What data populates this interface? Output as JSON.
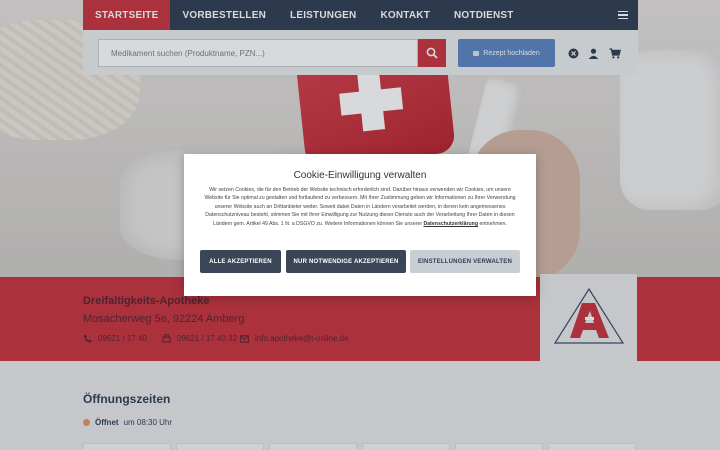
{
  "nav": {
    "items": [
      "STARTSEITE",
      "VORBESTELLEN",
      "LEISTUNGEN",
      "KONTAKT",
      "NOTDIENST"
    ],
    "active_index": 0,
    "menu_icon": "hamburger-icon"
  },
  "search": {
    "placeholder": "Medikament suchen (Produktname, PZN...)",
    "value": "",
    "button_icon": "search-icon"
  },
  "rezept": {
    "label": "Rezept hochladen",
    "icon": "camera-icon"
  },
  "header_icons": [
    "close-circle-icon",
    "user-icon",
    "cart-icon"
  ],
  "pharmacy": {
    "name": "Dreifaltigkeits-Apotheke",
    "address": "Mosacherweg 5e, 92224 Amberg",
    "phone": "09621 / 17 40",
    "fax": "09621 / 17 40 32",
    "email": "info.apotheke@t-online.de"
  },
  "hours": {
    "title": "Öffnungszeiten",
    "status_label": "Öffnet",
    "status_text": "um 08:30 Uhr"
  },
  "cookie_modal": {
    "title": "Cookie-Einwilligung verwalten",
    "text": "Wir setzen Cookies, die für den Betrieb der Website technisch erforderlich sind. Darüber hinaus verwenden wir Cookies, um unsere Website für Sie optimal zu gestalten und fortlaufend zu verbessern. Mit Ihrer Zustimmung geben wir Informationen zu Ihrer Verwendung unserer Website auch an Drittanbieter weiter. Soweit dabei Daten in Ländern verarbeitet werden, in denen kein angemessenes Datenschutzniveau besteht, stimmen Sie mit Ihrer Einwilligung zur Nutzung dieser Dienste auch der Verarbeitung Ihrer Daten in diesen Ländern gem. Artikel 49 Abs. 1 lit. a DSGVO zu. Weitere Informationen können Sie unserer",
    "privacy_link": "Datenschutzerklärung",
    "text_end": "entnehmen.",
    "buttons": {
      "accept_all": "ALLE AKZEPTIEREN",
      "necessary_only": "NUR NOTWENDIGE AKZEPTIEREN",
      "settings": "EINSTELLUNGEN VERWALTEN"
    }
  },
  "colors": {
    "brand_red": "#c8333f",
    "navy": "#2f3e55",
    "blue_button": "#5b86c5",
    "status_dot": "#e2955e"
  }
}
